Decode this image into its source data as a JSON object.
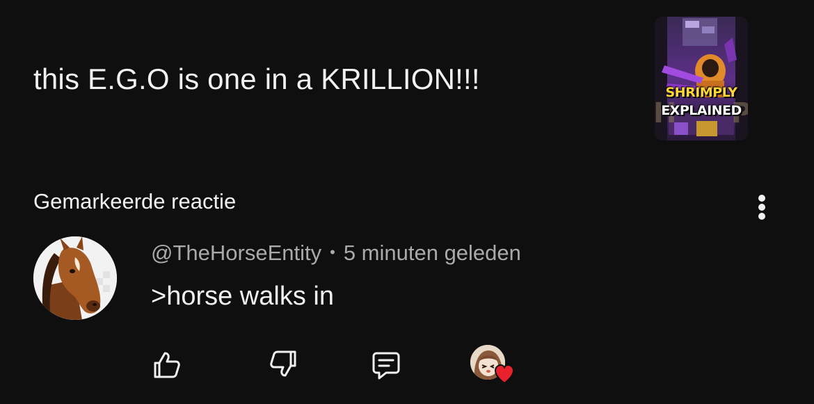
{
  "video": {
    "title": "this E.G.O is one in a KRILLION!!!",
    "thumbnail": {
      "line1": "SHRIMPLY",
      "line2": "EXPLAINED"
    }
  },
  "section": {
    "label": "Gemarkeerde reactie",
    "more_icon": "vertical-ellipsis-icon"
  },
  "comment": {
    "author": "@TheHorseEntity",
    "separator": "•",
    "time": "5 minuten geleden",
    "text": ">horse walks in",
    "avatar_icon": "horse-head-avatar"
  },
  "actions": {
    "like_icon": "thumbs-up-icon",
    "dislike_icon": "thumbs-down-icon",
    "reply_icon": "comment-bubble-icon",
    "creator_heart_icon": "creator-heart-icon",
    "heart_color": "#e8212c"
  },
  "colors": {
    "background": "#0f0f0f",
    "primary_text": "#f1f1f1",
    "secondary_text": "#aaaaaa"
  }
}
